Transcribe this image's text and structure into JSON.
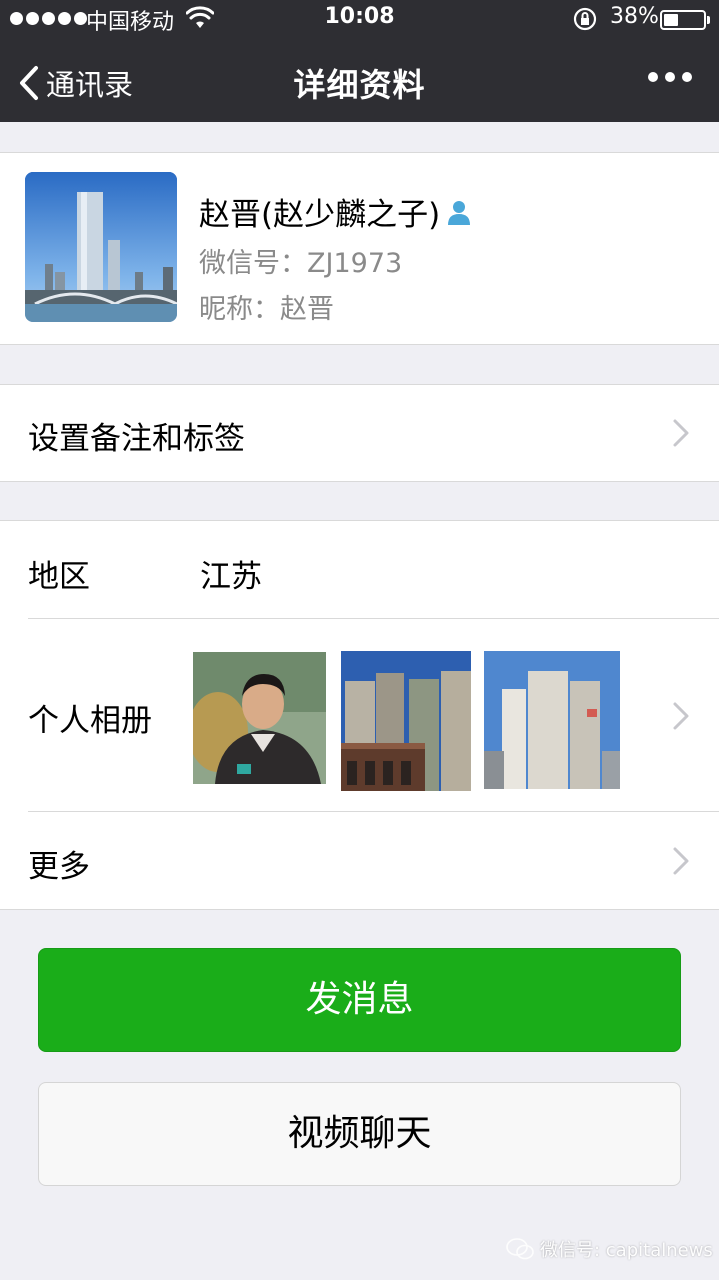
{
  "status_bar": {
    "carrier": "中国移动",
    "time": "10:08",
    "battery_percent": "38%",
    "battery_level": 0.38
  },
  "nav": {
    "back_label": "通讯录",
    "title": "详细资料"
  },
  "profile": {
    "name": "赵晋(赵少麟之子)",
    "wechat_id": "微信号：ZJ1973",
    "nickname": "昵称：赵晋"
  },
  "cells": {
    "remark_tags": "设置备注和标签",
    "region_label": "地区",
    "region_value": "江苏",
    "album_label": "个人相册",
    "more_label": "更多"
  },
  "buttons": {
    "send_message": "发消息",
    "video_chat": "视频聊天"
  },
  "watermark": "微信号: capitalnews",
  "colors": {
    "nav_bg": "#2e2e33",
    "page_bg": "#efeff4",
    "primary_green": "#1aad19"
  }
}
